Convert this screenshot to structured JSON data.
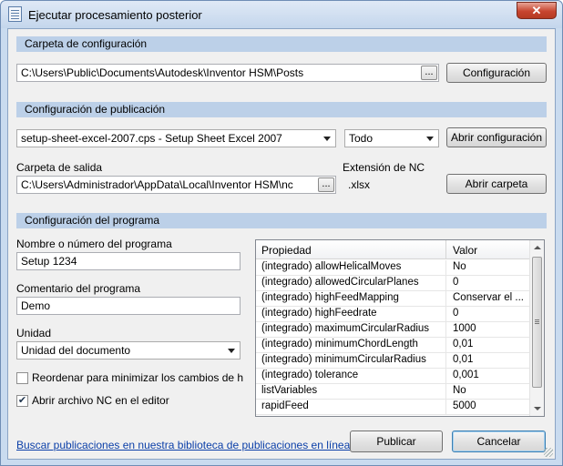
{
  "window": {
    "title": "Ejecutar procesamiento posterior",
    "close_glyph": "✕"
  },
  "config_folder": {
    "header": "Carpeta de configuración",
    "path": "C:\\Users\\Public\\Documents\\Autodesk\\Inventor HSM\\Posts",
    "browse_label": "...",
    "button_label": "Configuración"
  },
  "publication": {
    "header": "Configuración de publicación",
    "post_selected": "setup-sheet-excel-2007.cps - Setup Sheet Excel 2007",
    "filter_selected": "Todo",
    "open_config_label": "Abrir configuración",
    "output_folder_label": "Carpeta de salida",
    "output_folder_path": "C:\\Users\\Administrador\\AppData\\Local\\Inventor HSM\\nc",
    "output_browse_label": "...",
    "extension_label": "Extensión de NC",
    "extension_value": ".xlsx",
    "open_folder_label": "Abrir carpeta"
  },
  "program": {
    "header": "Configuración del programa",
    "name_label": "Nombre o número del programa",
    "name_value": "Setup 1234",
    "comment_label": "Comentario del programa",
    "comment_value": "Demo",
    "unit_label": "Unidad",
    "unit_selected": "Unidad del documento",
    "reorder_label": "Reordenar para minimizar los cambios de herrami",
    "reorder_checked": false,
    "open_nc_label": "Abrir archivo NC en el editor",
    "open_nc_checked": true,
    "checkmark": "✔"
  },
  "properties": {
    "col_property": "Propiedad",
    "col_value": "Valor",
    "rows": [
      {
        "name": "(integrado) allowHelicalMoves",
        "value": "No"
      },
      {
        "name": "(integrado) allowedCircularPlanes",
        "value": "0"
      },
      {
        "name": "(integrado) highFeedMapping",
        "value": "Conservar el ..."
      },
      {
        "name": "(integrado) highFeedrate",
        "value": "0"
      },
      {
        "name": "(integrado) maximumCircularRadius",
        "value": "1000"
      },
      {
        "name": "(integrado) minimumChordLength",
        "value": "0,01"
      },
      {
        "name": "(integrado) minimumCircularRadius",
        "value": "0,01"
      },
      {
        "name": "(integrado) tolerance",
        "value": "0,001"
      },
      {
        "name": "listVariables",
        "value": "No"
      },
      {
        "name": "rapidFeed",
        "value": "5000"
      }
    ]
  },
  "footer": {
    "link": "Buscar publicaciones en nuestra biblioteca de publicaciones en línea",
    "post_label": "Publicar",
    "cancel_label": "Cancelar"
  }
}
